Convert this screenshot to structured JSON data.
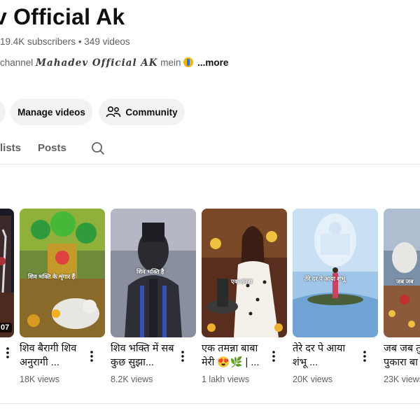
{
  "channel": {
    "name": "v Official Ak",
    "subscribers": "19.4K subscribers",
    "separator": " • ",
    "videos_count": "349 videos",
    "desc_prefix": "channel ",
    "desc_fancy": "Mahadev Official AK",
    "desc_suffix": " mein",
    "more_label": "...more"
  },
  "buttons": {
    "manage": "Manage videos",
    "community": "Community"
  },
  "tabs": {
    "lists": "lists",
    "posts": "Posts"
  },
  "icons": [
    "search-icon",
    "people-icon",
    "more-vert-icon",
    "folded-hands-emoji"
  ],
  "videos": [
    {
      "duration": "07",
      "title": "",
      "views": ""
    },
    {
      "title": "शिव बैरागी शिव अनुरागी ...",
      "views": "18K views",
      "overlay": "शिव भक्ति के शृंगार हैं"
    },
    {
      "title": "शिव भक्ति में सब कुछ सुझा...",
      "views": "8.2K views",
      "overlay": "शिव भक्ति है"
    },
    {
      "title": "एक तमन्ना बाबा मेरी 😍🌿 | ...",
      "views": "1 lakh views",
      "overlay": "एक तमन्ना"
    },
    {
      "title": "तेरे दर पे आया शंभू ...",
      "views": "20K views",
      "overlay": "तेरे दर पे आया शंभू"
    },
    {
      "title": "जब जब तु पुकारा बा",
      "views": "23K views",
      "overlay": "जब जब"
    }
  ]
}
